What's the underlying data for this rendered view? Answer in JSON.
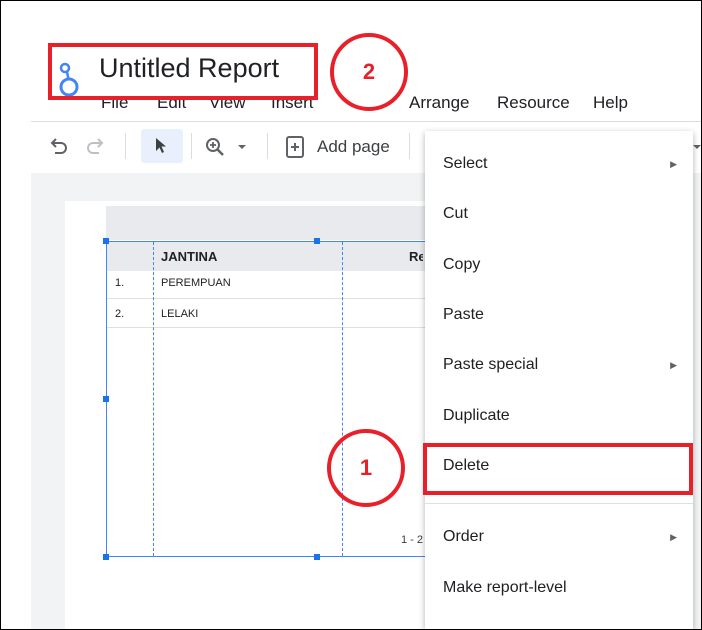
{
  "app": {
    "title": "Untitled Report"
  },
  "menubar": [
    "File",
    "Edit",
    "View",
    "Insert",
    "Arrange",
    "Resource",
    "Help"
  ],
  "toolbar": {
    "add_page_label": "Add page"
  },
  "table": {
    "headers": [
      "JANTINA",
      "Rekod"
    ],
    "rows": [
      {
        "index": "1.",
        "jantina": "PEREMPUAN"
      },
      {
        "index": "2.",
        "jantina": "LELAKI"
      }
    ],
    "pagination": "1 - 2"
  },
  "context_menu": {
    "items": [
      {
        "label": "Select",
        "submenu": true
      },
      {
        "label": "Cut",
        "submenu": false
      },
      {
        "label": "Copy",
        "submenu": false
      },
      {
        "label": "Paste",
        "submenu": false
      },
      {
        "label": "Paste special",
        "submenu": true
      },
      {
        "label": "Duplicate",
        "submenu": false
      },
      {
        "label": "Delete",
        "submenu": false
      },
      {
        "label": "Order",
        "submenu": true
      },
      {
        "label": "Make report-level",
        "submenu": false
      }
    ]
  },
  "annotations": {
    "step1": "1",
    "step2": "2",
    "color": "#e8202a"
  },
  "colors": {
    "selection": "#4285f4",
    "logo": "#4285f4"
  }
}
